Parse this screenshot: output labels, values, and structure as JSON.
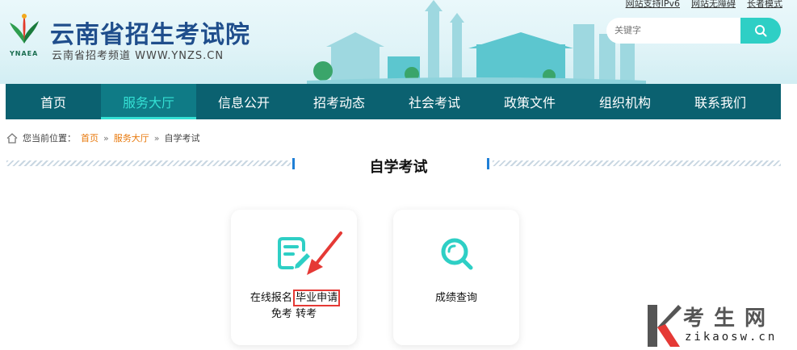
{
  "header": {
    "title": "云南省招生考试院",
    "subtitle": "云南省招考频道 WWW.YNZS.CN",
    "logo_text": "YNAEA",
    "top_links": [
      "网站支持IPv6",
      "网站无障碍",
      "长者模式"
    ],
    "search": {
      "placeholder": "关键字"
    }
  },
  "nav": {
    "items": [
      "首页",
      "服务大厅",
      "信息公开",
      "招考动态",
      "社会考试",
      "政策文件",
      "组织机构",
      "联系我们"
    ],
    "active_index": 1
  },
  "breadcrumb": {
    "prefix": "您当前位置：",
    "items": [
      "首页",
      "服务大厅",
      "自学考试"
    ],
    "separator": "»"
  },
  "section": {
    "title": "自学考试"
  },
  "cards": [
    {
      "icon": "form-edit-icon",
      "line1": [
        "在线报名",
        "毕业申请"
      ],
      "line2": [
        "免考",
        "转考"
      ]
    },
    {
      "icon": "search-result-icon",
      "line1": [
        "成绩查询"
      ]
    }
  ],
  "watermark": {
    "cn": "考生网",
    "en": "zikaosw.cn"
  },
  "colors": {
    "nav_bg": "#0b6170",
    "accent": "#34e0d4",
    "link_orange": "#e8790c",
    "highlight_red": "#e53935"
  }
}
